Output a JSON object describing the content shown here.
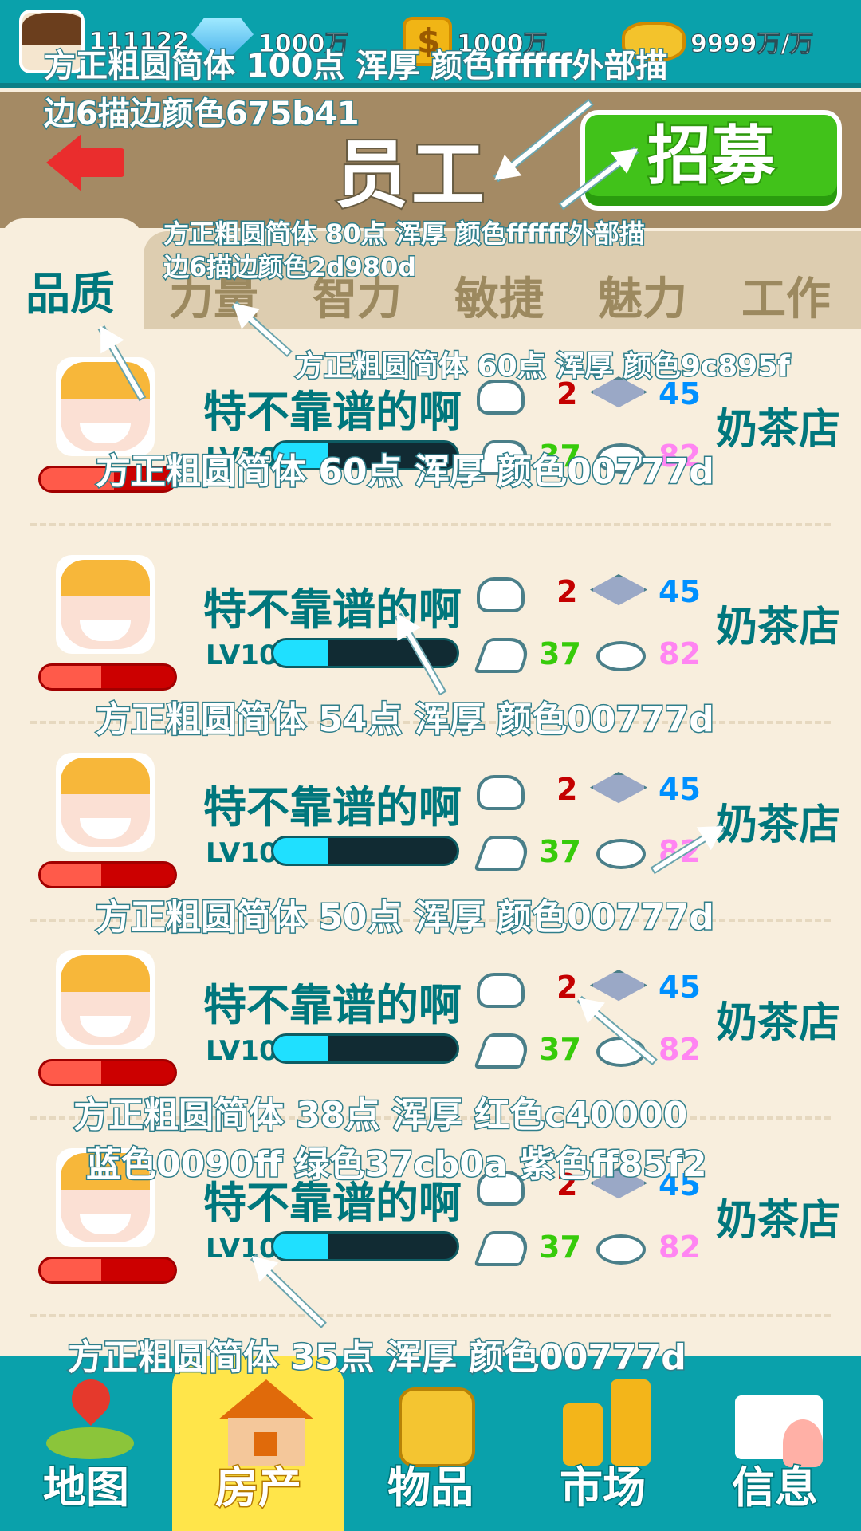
{
  "topbar": {
    "resources": [
      {
        "icon": "avatar-icon",
        "value": "111122"
      },
      {
        "icon": "diamond-icon",
        "value": "1000万"
      },
      {
        "icon": "coin-icon",
        "value": "1000万"
      },
      {
        "icon": "gold-stack-icon",
        "value": "9999万/万"
      }
    ]
  },
  "header": {
    "title": "员工",
    "recruit_label": "招募"
  },
  "tabs": {
    "active": "品质",
    "items": [
      "力量",
      "智力",
      "敏捷",
      "魅力",
      "工作"
    ]
  },
  "employees": [
    {
      "name": "特不靠谱的啊",
      "level": "LV10",
      "strength": "2",
      "intelligence": "45",
      "agility": "37",
      "charm": "82",
      "workplace": "奶茶店",
      "hp": 0.55,
      "xp": 0.3
    },
    {
      "name": "特不靠谱的啊",
      "level": "LV10",
      "strength": "2",
      "intelligence": "45",
      "agility": "37",
      "charm": "82",
      "workplace": "奶茶店",
      "hp": 0.45,
      "xp": 0.3
    },
    {
      "name": "特不靠谱的啊",
      "level": "LV10",
      "strength": "2",
      "intelligence": "45",
      "agility": "37",
      "charm": "82",
      "workplace": "奶茶店",
      "hp": 0.45,
      "xp": 0.3
    },
    {
      "name": "特不靠谱的啊",
      "level": "LV10",
      "strength": "2",
      "intelligence": "45",
      "agility": "37",
      "charm": "82",
      "workplace": "奶茶店",
      "hp": 0.45,
      "xp": 0.3
    },
    {
      "name": "特不靠谱的啊",
      "level": "LV10",
      "strength": "2",
      "intelligence": "45",
      "agility": "37",
      "charm": "82",
      "workplace": "奶茶店",
      "hp": 0.45,
      "xp": 0.3
    }
  ],
  "stat_colors": {
    "strength": "#c40000",
    "intelligence": "#0090ff",
    "agility": "#37cb0a",
    "charm": "#ff85f2"
  },
  "nav": {
    "items": [
      {
        "label": "地图",
        "icon": "map-pin-icon"
      },
      {
        "label": "房产",
        "icon": "house-icon"
      },
      {
        "label": "物品",
        "icon": "backpack-icon"
      },
      {
        "label": "市场",
        "icon": "market-icon"
      },
      {
        "label": "信息",
        "icon": "mail-icon"
      }
    ],
    "active_index": 1
  },
  "annotations": {
    "a1": "方正粗圆简体 100点   浑厚   颜色ffffff外部描",
    "a1b": "边6描边颜色675b41",
    "a2": "方正粗圆简体 80点    浑厚    颜色ffffff外部描",
    "a2b": "边6描边颜色2d980d",
    "a3": "方正粗圆简体  60点    浑厚    颜色9c895f",
    "a4": "方正粗圆简体  60点    浑厚    颜色00777d",
    "a5": "方正粗圆简体  54点    浑厚    颜色00777d",
    "a6": "方正粗圆简体  50点    浑厚    颜色00777d",
    "a7": "方正粗圆简体  38点    浑厚    红色c40000",
    "a7b": "蓝色0090ff   绿色37cb0a  紫色ff85f2",
    "a8": "方正粗圆简体  35点    浑厚    颜色00777d"
  }
}
